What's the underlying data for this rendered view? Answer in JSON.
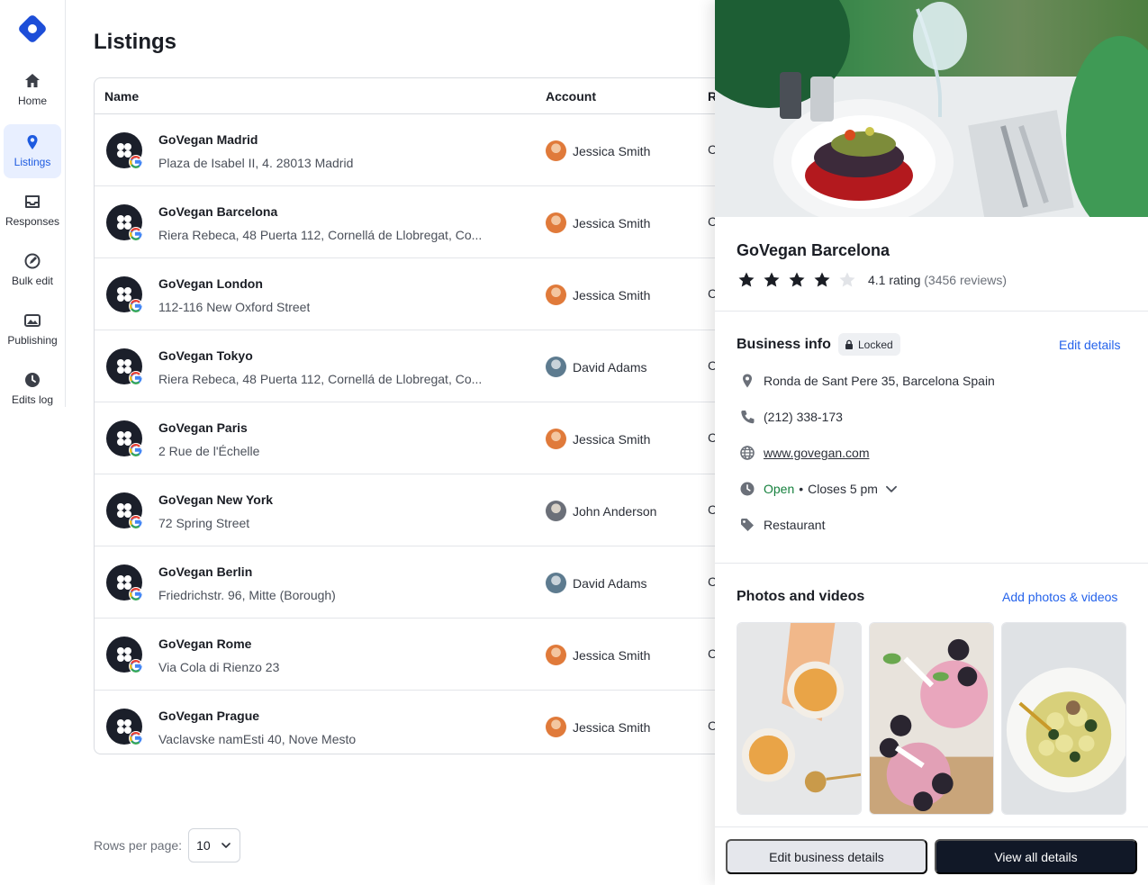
{
  "sidebar": {
    "items": [
      {
        "label": "Home",
        "icon": "home-icon"
      },
      {
        "label": "Listings",
        "icon": "location-pin-icon",
        "active": true
      },
      {
        "label": "Responses",
        "icon": "inbox-icon"
      },
      {
        "label": "Bulk edit",
        "icon": "bulk-edit-icon"
      },
      {
        "label": "Publishing",
        "icon": "images-icon"
      },
      {
        "label": "Edits log",
        "icon": "clock-icon"
      }
    ]
  },
  "page": {
    "title": "Listings"
  },
  "table": {
    "headers": {
      "name": "Name",
      "account": "Account",
      "r": "R"
    },
    "rows": [
      {
        "name": "GoVegan Madrid",
        "address": "Plaza de Isabel II, 4. 28013 Madrid",
        "account": "Jessica Smith",
        "col": "C"
      },
      {
        "name": "GoVegan Barcelona",
        "address": "Riera Rebeca, 48 Puerta 112, Cornellá de Llobregat, Co...",
        "account": "Jessica Smith",
        "col": "C"
      },
      {
        "name": "GoVegan London",
        "address": "112-116 New Oxford Street",
        "account": "Jessica Smith",
        "col": "C"
      },
      {
        "name": "GoVegan Tokyo",
        "address": "Riera Rebeca, 48 Puerta 112, Cornellá de Llobregat, Co...",
        "account": "David Adams",
        "col": "C"
      },
      {
        "name": "GoVegan Paris",
        "address": "2 Rue de l'Échelle",
        "account": "Jessica Smith",
        "col": "C"
      },
      {
        "name": "GoVegan New York",
        "address": "72 Spring Street",
        "account": "John Anderson",
        "col": "C"
      },
      {
        "name": "GoVegan Berlin",
        "address": "Friedrichstr. 96, Mitte (Borough)",
        "account": "David Adams",
        "col": "C"
      },
      {
        "name": "GoVegan Rome",
        "address": "Via Cola di Rienzo 23",
        "account": "Jessica Smith",
        "col": "C"
      },
      {
        "name": "GoVegan Prague",
        "address": "Vaclavske namEsti 40, Nove Mesto",
        "account": "Jessica Smith",
        "col": "C"
      }
    ]
  },
  "pagination": {
    "rows_label": "Rows per page:",
    "rows_value": "10"
  },
  "panel": {
    "title": "GoVegan Barcelona",
    "rating_value": 4.1,
    "rating_text": "4.1 rating",
    "reviews_text": "(3456 reviews)",
    "business_info": {
      "title": "Business info",
      "badge": "Locked",
      "edit_link": "Edit details",
      "address": "Ronda de Sant Pere 35, Barcelona Spain",
      "phone": "(212) 338-173",
      "website": "www.govegan.com",
      "status_open": "Open",
      "status_sep": "•",
      "closes": "Closes 5 pm",
      "category": "Restaurant"
    },
    "photos": {
      "title": "Photos and videos",
      "add_link": "Add photos & videos"
    },
    "buttons": {
      "secondary": "Edit business details",
      "primary": "View all details"
    }
  },
  "colors": {
    "accent": "#2563eb",
    "brand": "#1d4ed8",
    "open": "#15803d",
    "primary_button": "#111827"
  }
}
